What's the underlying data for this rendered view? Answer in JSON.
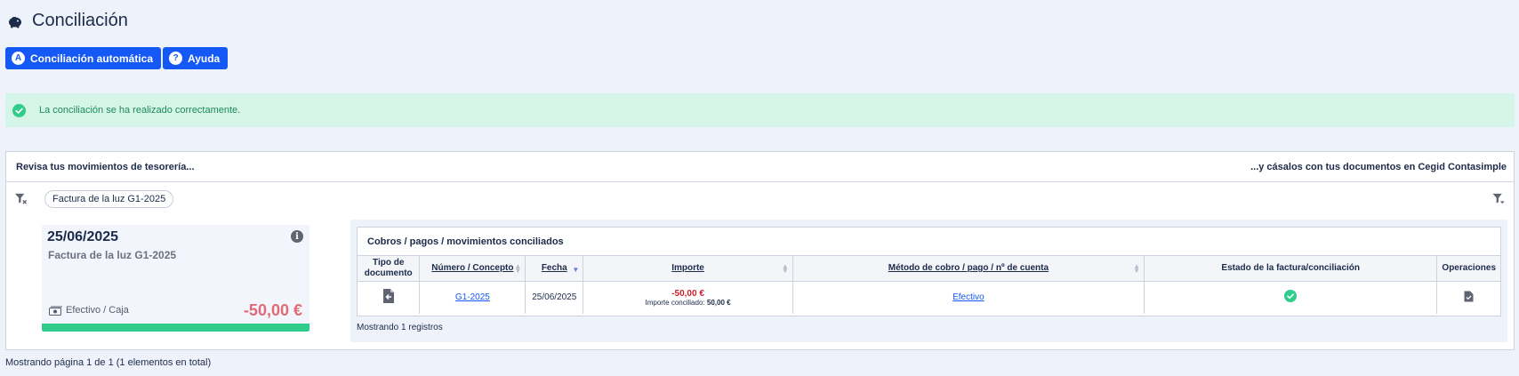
{
  "page": {
    "title": "Conciliación"
  },
  "toolbar": {
    "auto_label": "Conciliación automática",
    "auto_badge": "A",
    "help_label": "Ayuda",
    "help_badge": "?"
  },
  "alert": {
    "message": "La conciliación se ha realizado correctamente."
  },
  "panel": {
    "left_header": "Revisa tus movimientos de tesorería...",
    "right_header": "...y cásalos con tus documentos en Cegid Contasimple",
    "filter_chip": "Factura de la luz G1-2025"
  },
  "movement": {
    "date": "25/06/2025",
    "concept": "Factura de la luz G1-2025",
    "info_badge": "i",
    "method": "Efectivo / Caja",
    "amount": "-50,00 €",
    "conciliated_fraction": 1.0
  },
  "reconciled": {
    "title": "Cobros / pagos / movimientos conciliados",
    "columns": {
      "tipo_line1": "Tipo de",
      "tipo_line2": "documento",
      "numero": "Número / Concepto",
      "fecha": "Fecha",
      "importe": "Importe",
      "metodo": "Método de cobro / pago / nº de cuenta",
      "estado": "Estado de la factura/conciliación",
      "operaciones": "Operaciones"
    },
    "rows": [
      {
        "numero": "G1-2025",
        "fecha": "25/06/2025",
        "importe": "-50,00 €",
        "conciliado_label": "Importe conciliado:",
        "conciliado_value": "50,00 €",
        "metodo": "Efectivo"
      }
    ],
    "count_text": "Mostrando 1 registros"
  },
  "footer": {
    "pagination": "Mostrando página 1 de 1 (1 elementos en total)"
  },
  "colors": {
    "accent": "#1458f5",
    "success": "#2fcc8b",
    "negative": "#e06b77",
    "alert_bg": "#d4f5e7"
  }
}
